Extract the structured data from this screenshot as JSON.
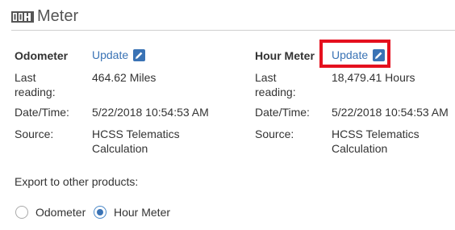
{
  "header": {
    "title": "Meter",
    "icon": "meter-icon"
  },
  "odometer": {
    "heading": "Odometer",
    "update_label": "Update",
    "last_reading_label_line1": "Last",
    "last_reading_label_line2": "reading:",
    "last_reading_value": "464.62 Miles",
    "datetime_label": "Date/Time:",
    "datetime_value": "5/22/2018 10:54:53 AM",
    "source_label": "Source:",
    "source_value_line1": "HCSS Telematics",
    "source_value_line2": "Calculation"
  },
  "hour_meter": {
    "heading": "Hour Meter",
    "update_label": "Update",
    "last_reading_label_line1": "Last",
    "last_reading_label_line2": "reading:",
    "last_reading_value": "18,479.41 Hours",
    "datetime_label": "Date/Time:",
    "datetime_value": "5/22/2018 10:54:53 AM",
    "source_label": "Source:",
    "source_value_line1": "HCSS Telematics",
    "source_value_line2": "Calculation"
  },
  "export": {
    "label": "Export to other products:",
    "options": [
      {
        "label": "Odometer",
        "selected": false
      },
      {
        "label": "Hour Meter",
        "selected": true
      }
    ]
  },
  "colors": {
    "link": "#3a73b5",
    "highlight": "#e5101e",
    "divider": "#cfcfcf"
  }
}
